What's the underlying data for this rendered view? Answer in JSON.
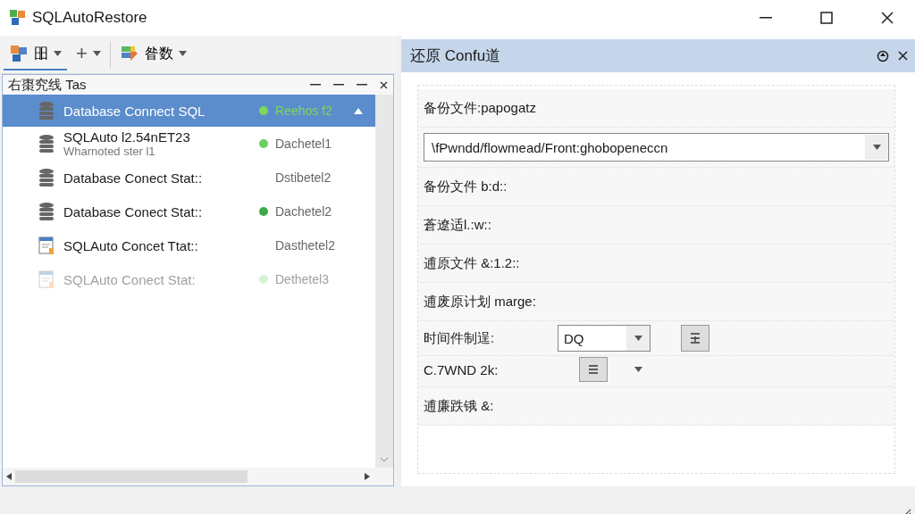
{
  "window": {
    "title": "SQLAutoRestore"
  },
  "toolbar": [
    {
      "kind": "menu",
      "label": "昍",
      "selected": true
    },
    {
      "kind": "add",
      "label": "+",
      "selected": false
    },
    {
      "kind": "chart",
      "label": "昝数",
      "selected": false
    }
  ],
  "task_panel": {
    "title": "右棗究线 Tas",
    "items": [
      {
        "kind": "database",
        "title": "Database Connect SQL",
        "status": "Reehos f2",
        "color": "#7ed957",
        "selected": true,
        "disabled": false
      },
      {
        "kind": "database",
        "title": "SQLAuto l2.54nET23",
        "subtitle": "Wharnoted ster l1",
        "status": "Dachetel1",
        "color": "#6ad060",
        "selected": false,
        "disabled": false
      },
      {
        "kind": "database",
        "title": "Database Conect Stat::",
        "status": "Dstibetel2",
        "selected": false,
        "disabled": false
      },
      {
        "kind": "database",
        "title": "Database Conect Stat::",
        "status": "Dachetel2",
        "color": "#3faa4a",
        "selected": false,
        "disabled": false
      },
      {
        "kind": "document",
        "title": "SQLAuto Concet Ttat::",
        "status": "Dasthetel2",
        "selected": false,
        "disabled": false
      },
      {
        "kind": "document",
        "title": "SQLAuto Conect Stat:",
        "status": "Dethetel3",
        "color": "#d6f2d6",
        "selected": false,
        "disabled": true
      }
    ]
  },
  "config_panel": {
    "title": "还原 Confu道",
    "rows": [
      {
        "kind": "label",
        "label": "备份文件:papogatz"
      },
      {
        "kind": "select",
        "value": "\\fPwndd/flowmead/Front:ghobopeneccn"
      },
      {
        "kind": "label",
        "label": "备份文件 b:d::"
      },
      {
        "kind": "label",
        "label": "蒼遼适l.:w::"
      },
      {
        "kind": "label",
        "label": "逋原文件 &:1.2::"
      },
      {
        "kind": "label",
        "label": "逋废原计划 marge:"
      },
      {
        "kind": "combo",
        "label": "时间件制逞:",
        "value": "DQ"
      },
      {
        "kind": "menu",
        "label": "C.7WND 2k:"
      },
      {
        "kind": "label",
        "label": "逋廉跌锇 &:"
      }
    ]
  }
}
